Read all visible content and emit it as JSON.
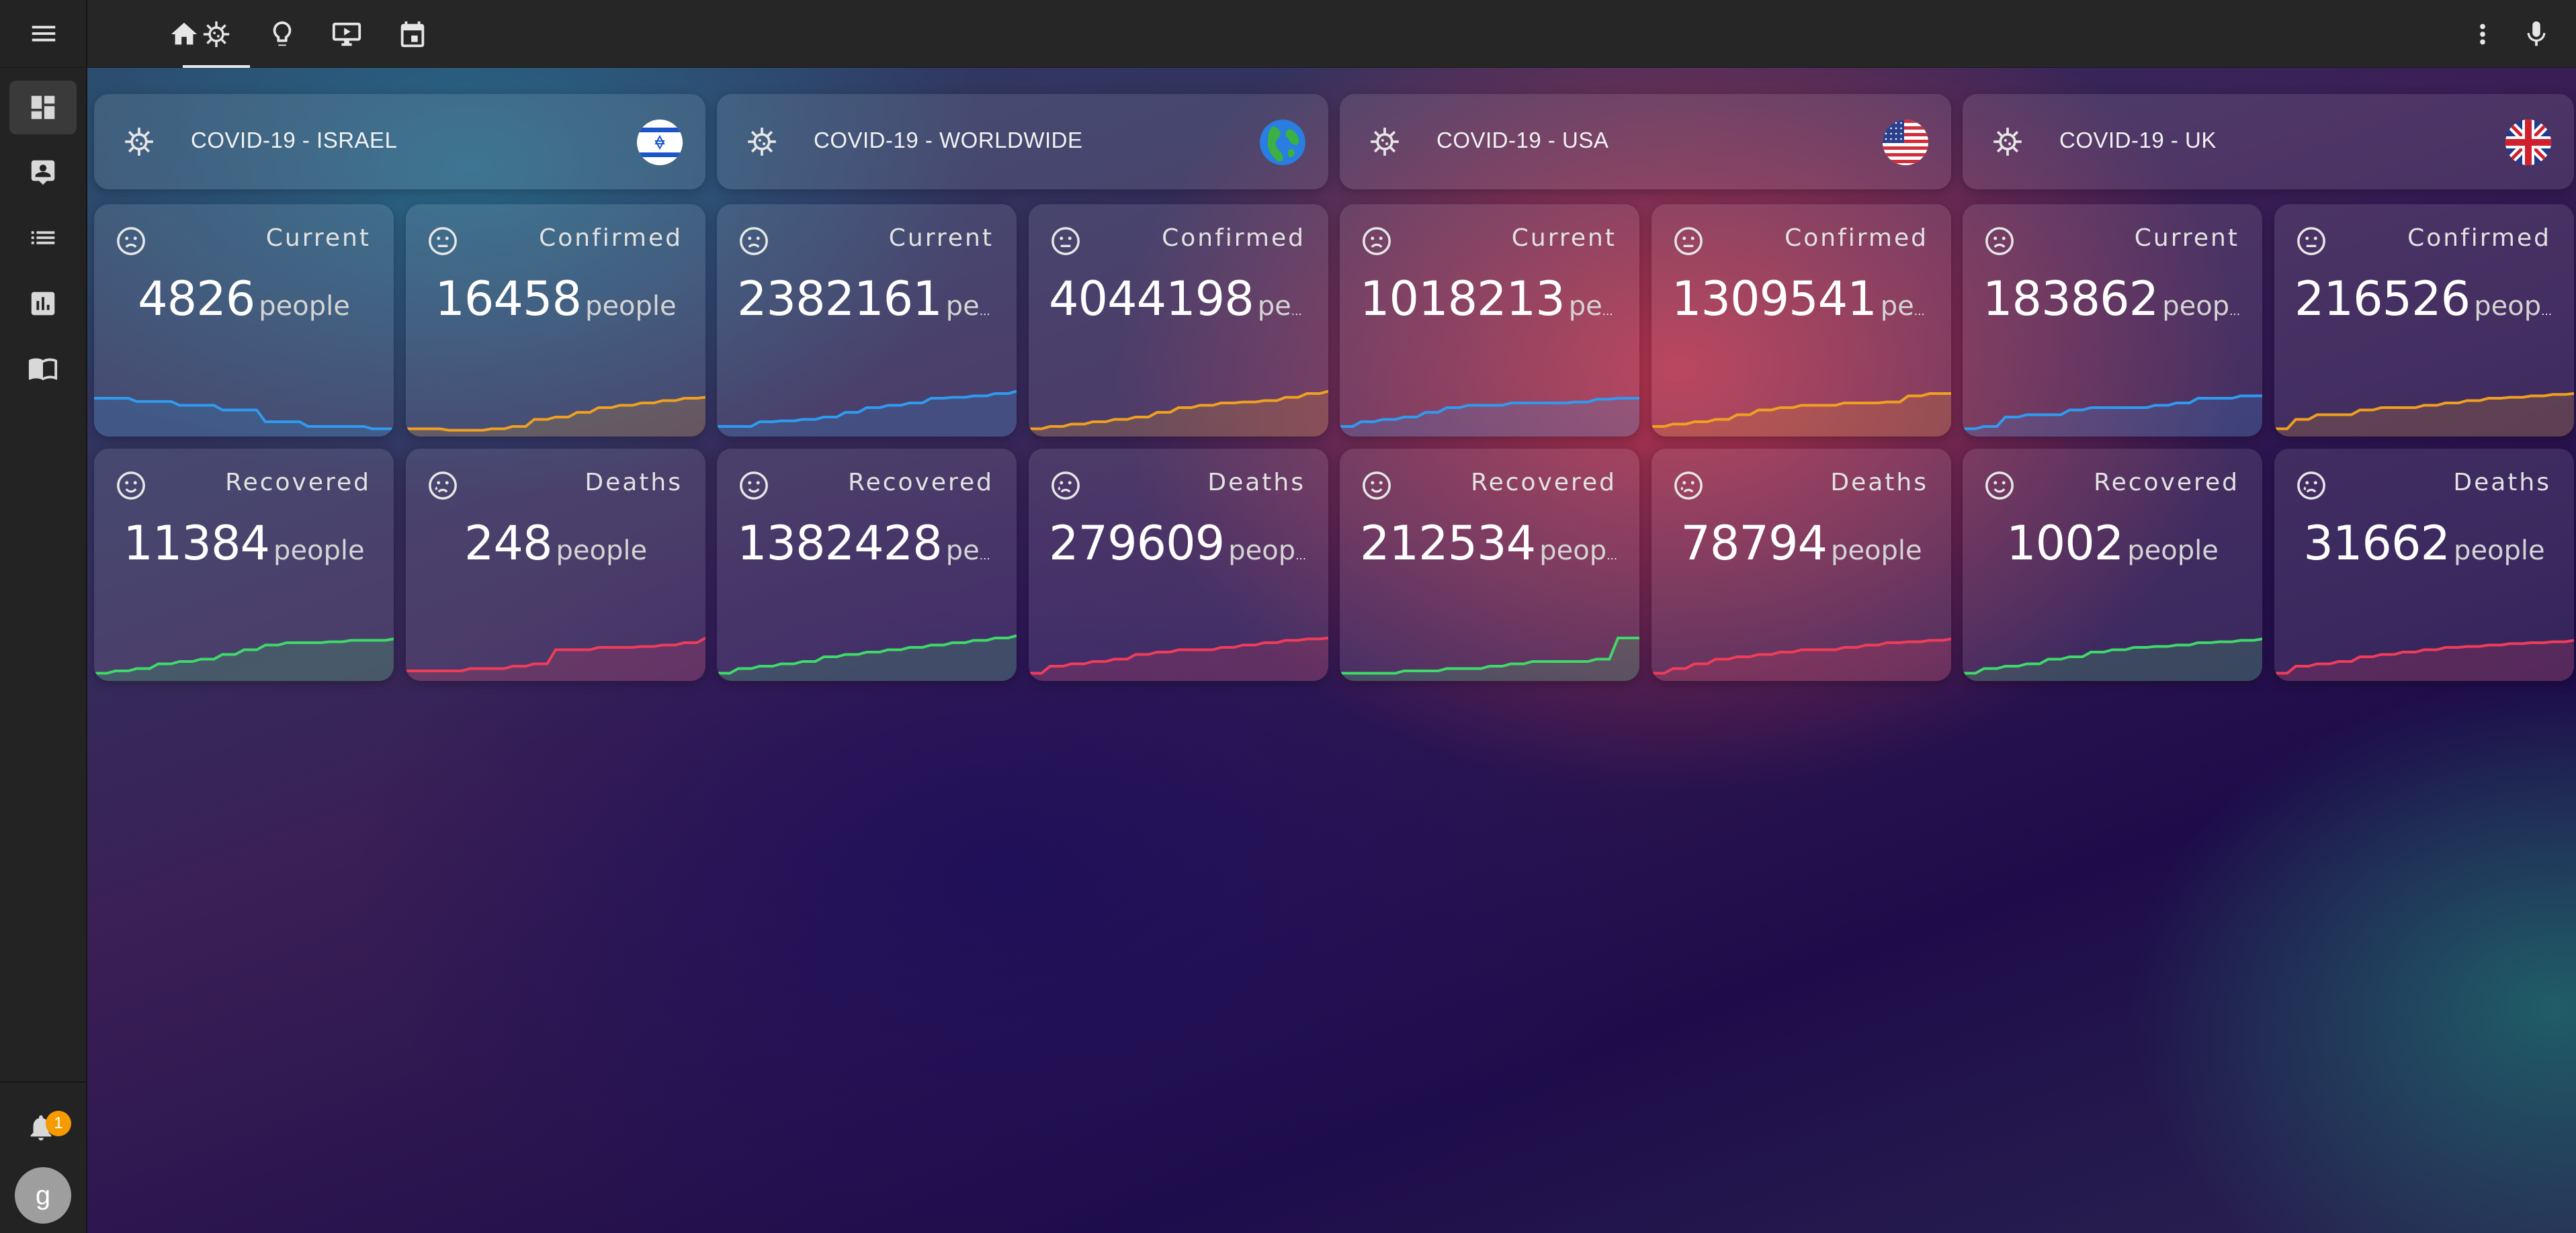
{
  "topbar": {
    "tabs": [
      {
        "icon": "home-icon",
        "active": false
      },
      {
        "icon": "virus-icon",
        "active": true
      },
      {
        "icon": "lightbulb-icon",
        "active": false
      },
      {
        "icon": "monitor-play-icon",
        "active": false
      },
      {
        "icon": "calendar-icon",
        "active": false
      }
    ],
    "right_icons": [
      "more-vertical-icon",
      "microphone-icon"
    ]
  },
  "sidebar": {
    "items": [
      {
        "icon": "dashboard-icon",
        "active": true
      },
      {
        "icon": "person-board-icon",
        "active": false
      },
      {
        "icon": "list-icon",
        "active": false
      },
      {
        "icon": "chart-icon",
        "active": false
      },
      {
        "icon": "book-icon",
        "active": false
      }
    ],
    "notification_count": "1",
    "avatar_letter": "g"
  },
  "colors": {
    "current": "#2f9bf0",
    "confirmed": "#f0a020",
    "recovered": "#3ed96a",
    "deaths": "#f03c5a"
  },
  "unit": "people",
  "regions": [
    {
      "title": "COVID-19 - ISRAEL",
      "flag": "israel",
      "stats": {
        "current": {
          "label": "Current",
          "value": "4826",
          "unit": "people"
        },
        "confirmed": {
          "label": "Confirmed",
          "value": "16458",
          "unit": "people"
        },
        "recovered": {
          "label": "Recovered",
          "value": "11384",
          "unit": "people"
        },
        "deaths": {
          "label": "Deaths",
          "value": "248",
          "unit": "people"
        }
      }
    },
    {
      "title": "COVID-19 - WORLDWIDE",
      "flag": "globe",
      "stats": {
        "current": {
          "label": "Current",
          "value": "2382161",
          "unit": "peo..."
        },
        "confirmed": {
          "label": "Confirmed",
          "value": "4044198",
          "unit": "pe..."
        },
        "recovered": {
          "label": "Recovered",
          "value": "1382428",
          "unit": "peo..."
        },
        "deaths": {
          "label": "Deaths",
          "value": "279609",
          "unit": "peop..."
        }
      }
    },
    {
      "title": "COVID-19 - USA",
      "flag": "usa",
      "stats": {
        "current": {
          "label": "Current",
          "value": "1018213",
          "unit": "people"
        },
        "confirmed": {
          "label": "Confirmed",
          "value": "1309541",
          "unit": "peo..."
        },
        "recovered": {
          "label": "Recovered",
          "value": "212534",
          "unit": "people"
        },
        "deaths": {
          "label": "Deaths",
          "value": "78794",
          "unit": "people"
        }
      }
    },
    {
      "title": "COVID-19 - UK",
      "flag": "uk",
      "stats": {
        "current": {
          "label": "Current",
          "value": "183862",
          "unit": "people"
        },
        "confirmed": {
          "label": "Confirmed",
          "value": "216526",
          "unit": "people"
        },
        "recovered": {
          "label": "Recovered",
          "value": "1002",
          "unit": "people"
        },
        "deaths": {
          "label": "Deaths",
          "value": "31662",
          "unit": "people"
        }
      }
    }
  ]
}
